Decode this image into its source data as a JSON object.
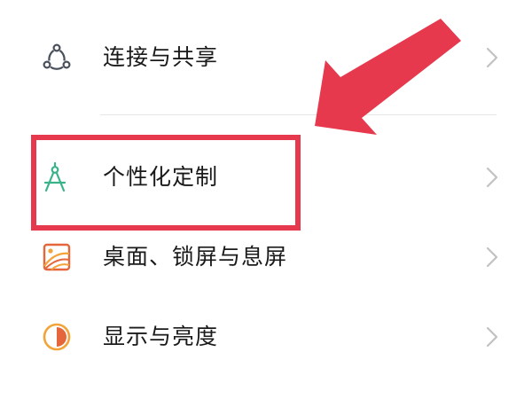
{
  "settings": {
    "items": [
      {
        "label": "连接与共享",
        "icon": "connection-share-icon"
      },
      {
        "label": "个性化定制",
        "icon": "compass-personalize-icon"
      },
      {
        "label": "桌面、锁屏与息屏",
        "icon": "wallpaper-icon"
      },
      {
        "label": "显示与亮度",
        "icon": "display-brightness-icon"
      }
    ]
  },
  "colors": {
    "highlight": "#e6394d",
    "label": "#1a1a1a",
    "chevron": "#c2c2c2",
    "connection_icon": "#4a4f5c",
    "personalize_icon": "#3bb38a",
    "wallpaper_icon": "#e5663a",
    "display_icon": "#f2a33a"
  }
}
